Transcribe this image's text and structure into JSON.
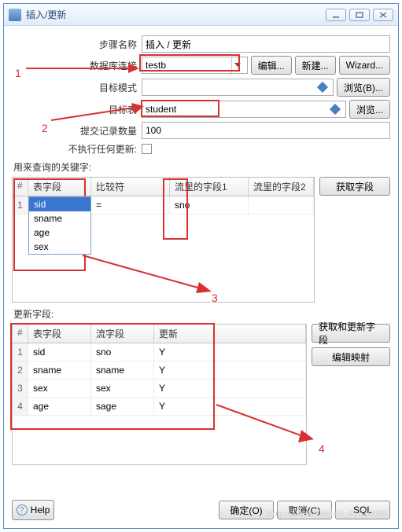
{
  "window": {
    "title": "插入/更新"
  },
  "form": {
    "step_name_label": "步骤名称",
    "step_name_value": "插入 / 更新",
    "db_conn_label": "数据库连接",
    "db_conn_value": "testb",
    "edit_btn": "编辑...",
    "new_btn": "新建...",
    "wizard_btn": "Wizard...",
    "target_schema_label": "目标模式",
    "target_schema_value": "",
    "browse_b_btn": "浏览(B)...",
    "target_table_label": "目标表",
    "target_table_value": "student",
    "browse_btn": "浏览...",
    "commit_size_label": "提交记录数量",
    "commit_size_value": "100",
    "no_update_label": "不执行任何更新:"
  },
  "keys": {
    "section": "用来查询的关键字:",
    "hash": "#",
    "col_field": "表字段",
    "col_compare": "比较符",
    "col_stream1": "流里的字段1",
    "col_stream2": "流里的字段2",
    "get_fields_btn": "获取字段",
    "row1_num": "1",
    "row1_field": "sid",
    "row1_compare": "=",
    "row1_stream1": "sno",
    "dd_options": [
      "sid",
      "sname",
      "age",
      "sex"
    ]
  },
  "updates": {
    "section": "更新字段:",
    "hash": "#",
    "col_field": "表字段",
    "col_stream": "流字段",
    "col_update": "更新",
    "get_update_fields_btn": "获取和更新字段",
    "edit_mapping_btn": "编辑映射",
    "rows": [
      {
        "n": "1",
        "field": "sid",
        "stream": "sno",
        "u": "Y"
      },
      {
        "n": "2",
        "field": "sname",
        "stream": "sname",
        "u": "Y"
      },
      {
        "n": "3",
        "field": "sex",
        "stream": "sex",
        "u": "Y"
      },
      {
        "n": "4",
        "field": "age",
        "stream": "sage",
        "u": "Y"
      }
    ]
  },
  "footer": {
    "help": "Help",
    "ok": "确定(O)",
    "cancel": "取消(C)",
    "sql": "SQL"
  },
  "annotations": {
    "a1": "1",
    "a2": "2",
    "a3": "3",
    "a4": "4"
  },
  "watermark": "blog.csdn.net/weixin_41620638"
}
